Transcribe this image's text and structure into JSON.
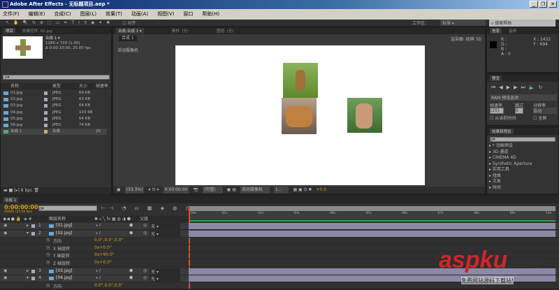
{
  "window": {
    "title": "Adobe After Effects - 无标题项目.aep *",
    "min": "_",
    "max": "❐",
    "close": "✕"
  },
  "menu": [
    "文件(F)",
    "编辑(E)",
    "合成(C)",
    "图层(L)",
    "效果(T)",
    "动画(A)",
    "视图(V)",
    "窗口",
    "帮助(H)"
  ],
  "toolbar": {
    "tools": [
      "↖",
      "✋",
      "🔍",
      "↻",
      "⊕",
      "⬚",
      "▭",
      "✒",
      "T",
      "/",
      "⚲",
      "◆",
      "✦",
      "✱"
    ],
    "align_label": "对齐",
    "workspace_label": "工作区:",
    "workspace_value": "标准",
    "search_help": "搜索帮助"
  },
  "project": {
    "tab": "项目",
    "tab2": "效果控件: 02.jpg",
    "comp_name": "合成 1 ▾",
    "comp_size": "1280 x 720 (1.00)",
    "comp_duration": "Δ 0:00:10:00, 25.00 fps",
    "search": "ρ▾",
    "headers": {
      "name": "名称",
      "type": "类型",
      "size": "大小",
      "fps": "帧速率"
    },
    "items": [
      {
        "name": "01.jpg",
        "type": "JPEG",
        "size": "69 KB",
        "fps": ""
      },
      {
        "name": "02.jpg",
        "type": "JPEG",
        "size": "63 KB",
        "fps": ""
      },
      {
        "name": "03.jpg",
        "type": "JPEG",
        "size": "64 KB",
        "fps": ""
      },
      {
        "name": "04.jpg",
        "type": "JPEG",
        "size": "103 KB",
        "fps": ""
      },
      {
        "name": "05.jpg",
        "type": "JPEG",
        "size": "64 KB",
        "fps": ""
      },
      {
        "name": "06.jpg",
        "type": "JPEG",
        "size": "74 KB",
        "fps": ""
      },
      {
        "name": "合成 1",
        "type": "合成",
        "size": "",
        "fps": "25"
      }
    ],
    "bpc": "8 bpc"
  },
  "viewer": {
    "tab": "合成:合成 1 ▾",
    "tab_footage": "素材: (无)",
    "tab_layer": "图层: (无)",
    "comp_chip": "合成 1",
    "camera_label": "活动摄像机",
    "renderer": "渲染器: 经典 3D",
    "zoom": "(33.3%)",
    "timecode": "0:00:00:00",
    "resolution": "(完整)",
    "view": "活动摄像机",
    "views": "1...",
    "exposure": "+0.0"
  },
  "info": {
    "tab": "信息",
    "tab2": "音频",
    "r": "R :",
    "g": "G :",
    "b": "B :",
    "a": "A : 0",
    "x": "X : 1432",
    "y": "Y : 694"
  },
  "preview": {
    "tab": "预览",
    "ram": "RAM 预览选项",
    "fps_label": "帧速率",
    "skip_label": "跳过",
    "res_label": "分辨率",
    "fps": "(25)",
    "skip": "0",
    "res": "自动",
    "from_current": "从当前时间",
    "fullscreen": "全屏"
  },
  "effects": {
    "tab": "效果和预设",
    "search": "ρ▾",
    "items": [
      "* 动画预设",
      "3D 通道",
      "CINEMA 4D",
      "Synthetic Aperture",
      "实用工具",
      "扭曲",
      "文本",
      "时间"
    ]
  },
  "timeline": {
    "tab": "合成 1",
    "timecode": "0:00:00:00",
    "frame_info": "00000 (25.00 fps)",
    "search": "ρ▾",
    "col_name": "图层名称",
    "col_parent": "父级",
    "ruler": [
      "00s",
      "01s",
      "02s",
      "03s",
      "04s",
      "05s",
      "06s",
      "07s",
      "08s",
      "09s",
      "10s"
    ],
    "rows": [
      {
        "kind": "layer",
        "num": "1",
        "name": "[01.jpg]",
        "parent": "无"
      },
      {
        "kind": "layer",
        "num": "2",
        "name": "[02.jpg]",
        "parent": "无"
      },
      {
        "kind": "prop",
        "name": "方向",
        "value": "0.0°,0.0°,0.0°"
      },
      {
        "kind": "prop",
        "name": "X 轴旋转",
        "value": "0x+0.0°"
      },
      {
        "kind": "prop",
        "name": "Y 轴旋转",
        "value": "0x+90.0°"
      },
      {
        "kind": "prop",
        "name": "Z 轴旋转",
        "value": "0x+0.0°"
      },
      {
        "kind": "layer",
        "num": "3",
        "name": "[03.jpg]",
        "parent": "无"
      },
      {
        "kind": "layer",
        "num": "4",
        "name": "[04.jpg]",
        "parent": "无"
      },
      {
        "kind": "prop",
        "name": "方向",
        "value": "0.0°,0.0°,0.0°"
      }
    ]
  },
  "watermark": {
    "brand": "aspku",
    "tld": ".com",
    "tagline": "免费网站源码下载站!"
  }
}
